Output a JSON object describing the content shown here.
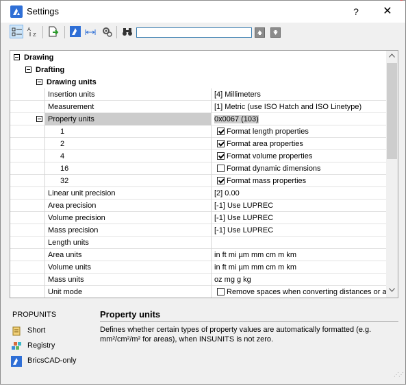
{
  "window": {
    "title": "Settings",
    "help_label": "?",
    "close_label": "✕"
  },
  "toolbar": {
    "search_value": "",
    "icons": [
      "categorized-view-icon",
      "alphabetic-view-icon",
      "export-icon",
      "bricscad-icon",
      "dimension-icon",
      "gear-filter-icon",
      "binoculars-icon",
      "search-up-icon",
      "search-down-icon"
    ]
  },
  "tree": {
    "drawing": "Drawing",
    "drafting": "Drafting",
    "drawing_units": "Drawing units"
  },
  "props": [
    {
      "label": "Insertion units",
      "value": "[4] Millimeters"
    },
    {
      "label": "Measurement",
      "value": "[1] Metric (use ISO Hatch and ISO Linetype)"
    },
    {
      "label": "Property units",
      "value": "0x0067 (103)"
    },
    {
      "label": "1",
      "value": "Format length properties",
      "checked": true
    },
    {
      "label": "2",
      "value": "Format area properties",
      "checked": true
    },
    {
      "label": "4",
      "value": "Format volume properties",
      "checked": true
    },
    {
      "label": "16",
      "value": "Format dynamic dimensions",
      "checked": false
    },
    {
      "label": "32",
      "value": "Format mass properties",
      "checked": true
    },
    {
      "label": "Linear unit precision",
      "value": "[2] 0.00"
    },
    {
      "label": "Area precision",
      "value": "[-1] Use LUPREC"
    },
    {
      "label": "Volume precision",
      "value": "[-1] Use LUPREC"
    },
    {
      "label": "Mass precision",
      "value": "[-1] Use LUPREC"
    },
    {
      "label": "Length units",
      "value": ""
    },
    {
      "label": "Area units",
      "value": "in ft mi µm mm cm m km"
    },
    {
      "label": "Volume units",
      "value": "in ft mi µm mm cm m km"
    },
    {
      "label": "Mass units",
      "value": "oz mg g kg"
    },
    {
      "label": "Unit mode",
      "value": "Remove spaces when converting distances or an",
      "checked": false
    }
  ],
  "info": {
    "command": "PROPUNITS",
    "short": "Short",
    "registry": "Registry",
    "bricscad_only": "BricsCAD-only",
    "title": "Property units",
    "description": "Defines whether certain types of property values are automatically formatted (e.g. mm²/cm²/m² for areas), when INSUNITS is not zero."
  },
  "colors": {
    "accent": "#2f6fd6",
    "selection": "#cccccc",
    "toolbar_active": "#cde4f7"
  }
}
